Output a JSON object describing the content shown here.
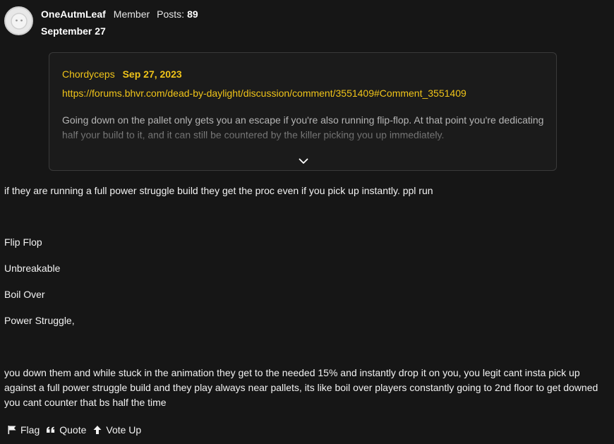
{
  "author": {
    "name": "OneAutmLeaf",
    "role": "Member",
    "posts_label": "Posts:",
    "posts_count": "89",
    "date": "September 27"
  },
  "quote": {
    "author": "Chordyceps",
    "date": "Sep 27, 2023",
    "link": "https://forums.bhvr.com/dead-by-daylight/discussion/comment/3551409#Comment_3551409",
    "body": "Going down on the pallet only gets you an escape if you're also running flip-flop. At that point you're dedicating half your build to it, and it can still be countered by the killer picking you up immediately."
  },
  "body": {
    "line1": "if they are running a full power struggle build they get the proc even if you pick up instantly. ppl run",
    "perks": [
      "Flip Flop",
      "Unbreakable",
      "Boil Over",
      "Power Struggle,"
    ],
    "para_lines": [
      "you down them and while stuck in the animation they get to the needed 15% and instantly drop it on you, you legit cant insta pick up",
      "against a full power struggle build and they play always near pallets, its like boil over players constantly going to 2nd floor to get downed",
      "you cant counter that bs half the time"
    ]
  },
  "actions": {
    "flag": "Flag",
    "quote": "Quote",
    "vote_up": "Vote Up"
  },
  "colors": {
    "background": "#161616",
    "accent": "#f0c419",
    "text": "#f2f2f2"
  }
}
